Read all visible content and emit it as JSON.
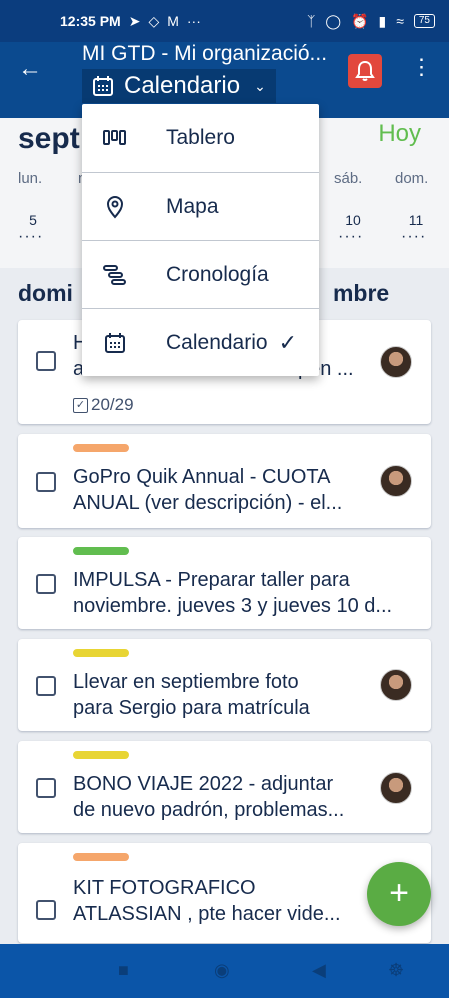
{
  "status_bar": {
    "time": "12:35 PM",
    "battery": "75"
  },
  "app_bar": {
    "board_title": "MI GTD - Mi organizació...",
    "current_view": "Calendario",
    "accent": "#0b4a8f",
    "bell_color": "#e2483d"
  },
  "calendar": {
    "month": "sept",
    "today_label": "Hoy",
    "weekdays": [
      "lun.",
      "m",
      "sáb.",
      "dom."
    ],
    "days": [
      "5",
      "10",
      "11"
    ]
  },
  "day_heading": {
    "left": "domi",
    "right": "mbre"
  },
  "menu": {
    "items": [
      {
        "label": "Tablero",
        "icon": "board-icon"
      },
      {
        "label": "Mapa",
        "icon": "map-pin-icon"
      },
      {
        "label": "Cronología",
        "icon": "timeline-icon"
      },
      {
        "label": "Calendario",
        "icon": "calendar-icon",
        "selected": true
      }
    ]
  },
  "cards": [
    {
      "title_line1": "H",
      "title_line2": "a",
      "title_line2_tail": "pen ...",
      "checklist": "20/29",
      "label_color": null
    },
    {
      "title_line1": "GoPro Quik Annual - CUOTA",
      "title_line2": "ANUAL (ver descripción) - el...",
      "label_color": "#f5a66b"
    },
    {
      "title_line1": "IMPULSA - Preparar taller para",
      "title_line2": "noviembre. jueves 3 y jueves 10 d...",
      "label_color": "#61bd4f"
    },
    {
      "title_line1": "Llevar en septiembre foto",
      "title_line2": "para Sergio para matrícula",
      "label_color": "#e8d534"
    },
    {
      "title_line1": "BONO VIAJE 2022 - adjuntar",
      "title_line2": "de nuevo padrón, problemas...",
      "label_color": "#e8d534"
    },
    {
      "title_line1": "KIT FOTOGRAFICO",
      "title_line2": "ATLASSIAN , pte hacer vide...",
      "label_color": "#f5a66b"
    }
  ],
  "fab_label": "+"
}
